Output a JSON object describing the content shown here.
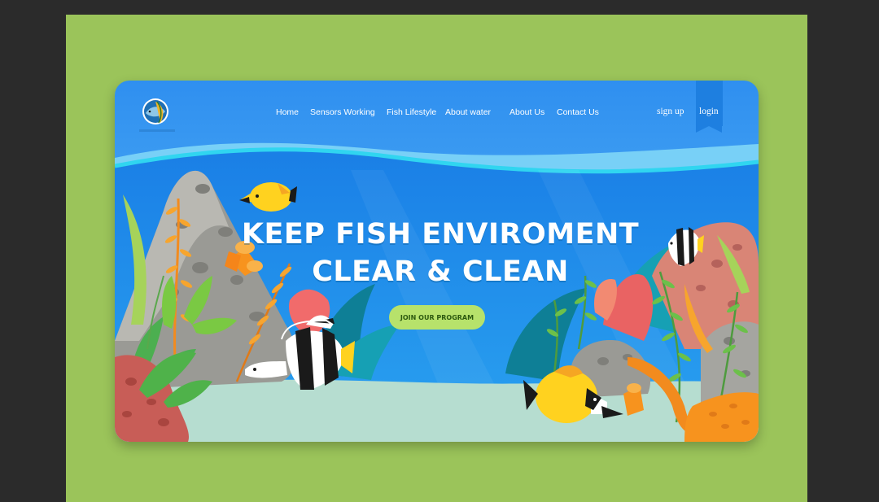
{
  "brand": {
    "logo_icon": "fish-logo-icon"
  },
  "nav": {
    "items": [
      {
        "label": "Home"
      },
      {
        "label": "Sensors Working"
      },
      {
        "label": "Fish Lifestyle"
      },
      {
        "label": "About water"
      },
      {
        "label": "About Us"
      },
      {
        "label": "Contact Us"
      }
    ],
    "signup_label": "sign up",
    "login_label": "login"
  },
  "hero": {
    "headline_line1": "KEEP FISH ENVIROMENT",
    "headline_line2": "CLEAR & CLEAN",
    "cta_label": "JOIN OUR PROGRAM"
  },
  "colors": {
    "background": "#9bc45a",
    "water": "#1e88e5",
    "cta": "#b7e26b",
    "login_tab": "#1e7fe0"
  }
}
